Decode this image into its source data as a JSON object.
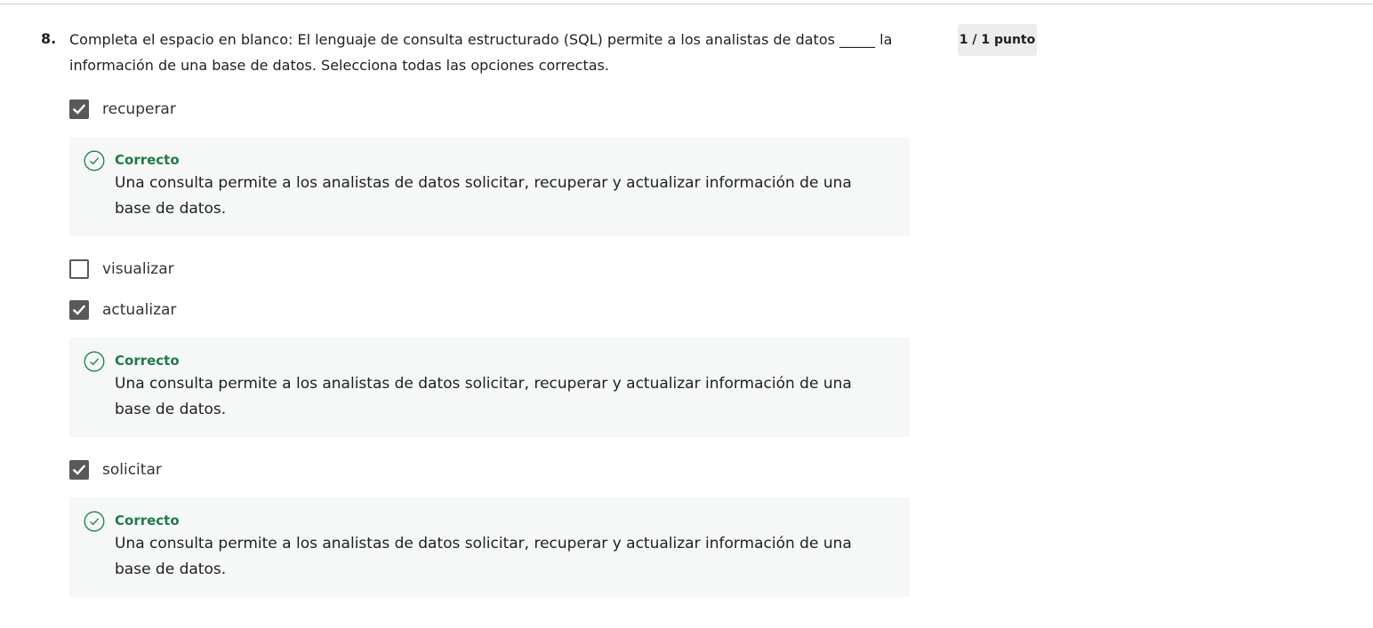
{
  "question": {
    "number": "8.",
    "text": "Completa el espacio en blanco: El lenguaje de consulta estructurado (SQL) permite a los analistas de datos _____ la información de una base de datos. Selecciona todas las opciones correctas.",
    "points": "1 / 1 punto"
  },
  "options": [
    {
      "label": "recuperar",
      "checked": true,
      "feedback": {
        "title": "Correcto",
        "text": "Una consulta permite a los analistas de datos solicitar, recuperar y actualizar información de una base de datos."
      }
    },
    {
      "label": "visualizar",
      "checked": false
    },
    {
      "label": "actualizar",
      "checked": true,
      "feedback": {
        "title": "Correcto",
        "text": "Una consulta permite a los analistas de datos solicitar, recuperar y actualizar información de una base de datos."
      }
    },
    {
      "label": "solicitar",
      "checked": true,
      "feedback": {
        "title": "Correcto",
        "text": "Una consulta permite a los analistas de datos solicitar, recuperar y actualizar información de una base de datos."
      }
    }
  ],
  "colors": {
    "correct_green": "#1f7a4a",
    "checkbox_gray": "#595959",
    "feedback_bg": "#f5f8f7"
  },
  "icons": {
    "checked": "checkmark-icon",
    "feedback": "check-circle-icon"
  }
}
